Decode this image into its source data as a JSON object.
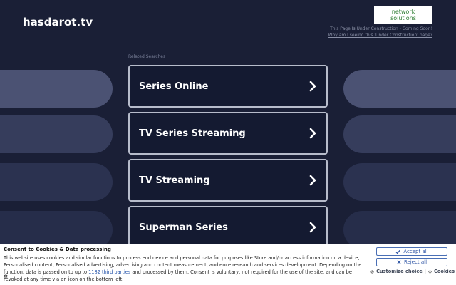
{
  "header": {
    "site_title": "hasdarot.tv",
    "logo_line1": "network",
    "logo_line2": "solutions",
    "uc_notice": "This Page Is Under Construction - Coming Soon!",
    "uc_link": "Why am I seeing this 'Under Construction' page?"
  },
  "related": {
    "label": "Related Searches",
    "items": [
      {
        "label": "Series Online"
      },
      {
        "label": "TV Series Streaming"
      },
      {
        "label": "TV Streaming"
      },
      {
        "label": "Superman Series"
      }
    ]
  },
  "consent": {
    "title": "Consent to Cookies & Data processing",
    "body_before": "This website uses cookies and similar functions to process end device and personal data for purposes like Store and/or access information on a device, Personalised content, Personalised advertising, advertising and content measurement, audience research and services development. Depending on the function, data is passed on to up to ",
    "third_parties_link": "1182 third parties",
    "body_after": " and processed by them. Consent is voluntary, not required for the use of the site, and can be revoked at any time via an icon on the bottom left.",
    "accept_label": "Accept all",
    "reject_label": "Reject all",
    "customize_label": "Customize choice",
    "separator": "|",
    "cookies_label": "Cookies"
  },
  "colors": {
    "background": "#1a1f36",
    "card_border": "#b7bccb",
    "link_blue": "#1e4fa8"
  },
  "icons": {
    "card_arrow": "chevron-right-icon",
    "accept": "check-icon",
    "reject": "x-icon",
    "customize": "gear-icon",
    "cookies": "diamond-icon",
    "revoke": "fingerprint-icon"
  }
}
